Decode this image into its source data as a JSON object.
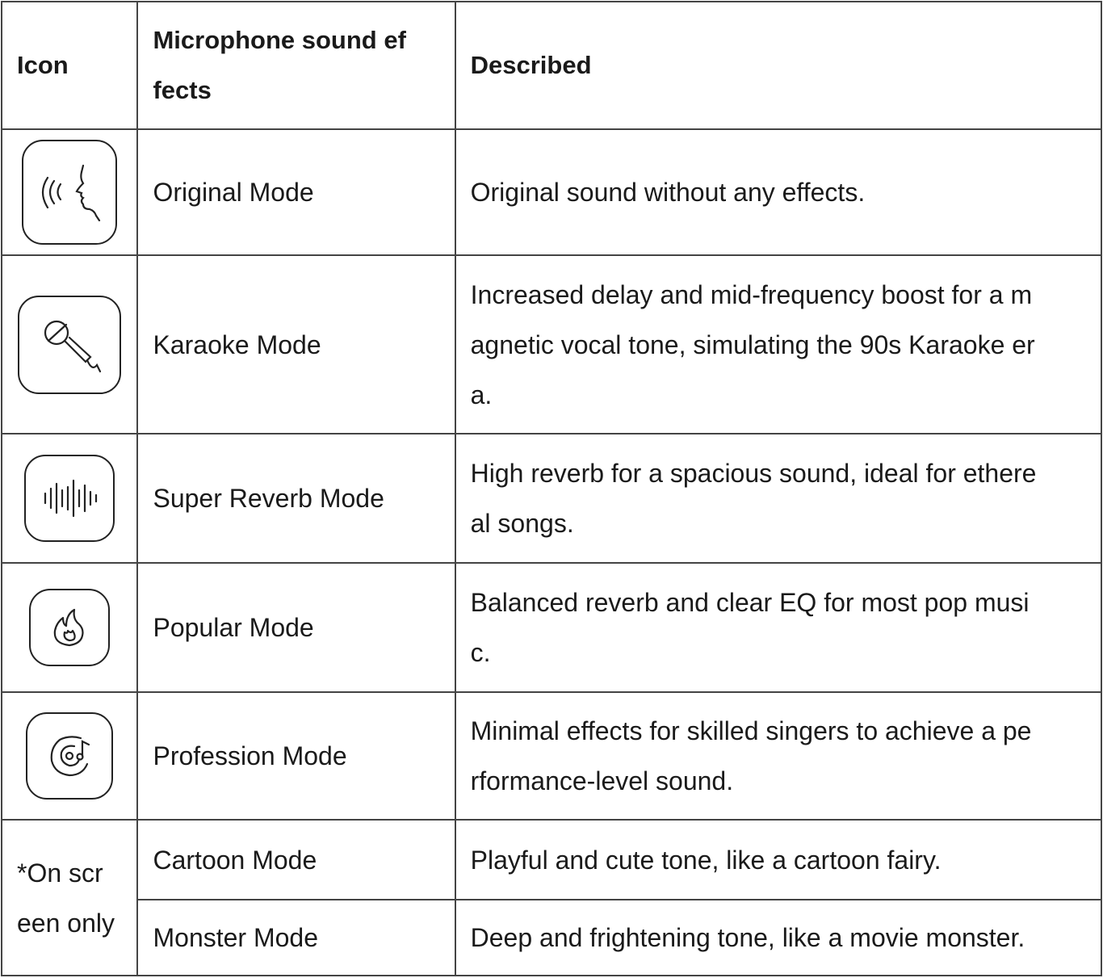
{
  "header": {
    "icon": "Icon",
    "effect": "Microphone sound ef fects",
    "effect_line1": "Microphone sound ef",
    "effect_line2": "fects",
    "described": "Described"
  },
  "rows": [
    {
      "icon": "voice-waves-icon",
      "mode": "Original Mode",
      "desc_lines": [
        "Original sound without any effects."
      ]
    },
    {
      "icon": "microphone-icon",
      "mode": "Karaoke Mode",
      "desc_lines": [
        "Increased delay and mid-frequency boost for a m",
        "agnetic vocal tone, simulating the 90s Karaoke er",
        "a."
      ]
    },
    {
      "icon": "sound-wave-icon",
      "mode": "Super Reverb Mode",
      "desc_lines": [
        "High reverb for a spacious sound, ideal for ethere",
        "al songs."
      ]
    },
    {
      "icon": "flame-icon",
      "mode": "Popular Mode",
      "desc_lines": [
        "Balanced reverb and clear EQ for most pop musi",
        "c."
      ]
    },
    {
      "icon": "music-disc-icon",
      "mode": "Profession Mode",
      "desc_lines": [
        "Minimal effects for skilled singers to achieve a pe",
        "rformance-level sound."
      ]
    }
  ],
  "screen_only": {
    "note_line1": "*On scr",
    "note_line2": "een only",
    "rows": [
      {
        "mode": "Cartoon Mode",
        "desc": "Playful and cute tone, like a cartoon fairy."
      },
      {
        "mode": "Monster Mode",
        "desc": "Deep and frightening tone, like a movie monster."
      }
    ]
  }
}
